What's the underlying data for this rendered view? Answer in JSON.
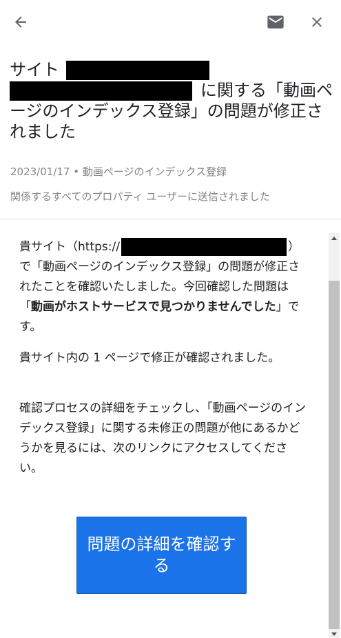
{
  "header": {
    "back_icon": "arrow-back-icon",
    "mail_icon": "mail-icon",
    "close_icon": "close-icon"
  },
  "title": {
    "prefix": "サイト",
    "suffix": "に関する「動画ページのインデックス登録」の問題が修正されました"
  },
  "meta": {
    "line1": "2023/01/17 • 動画ページのインデックス登録",
    "line2": "関係するすべてのプロパティ ユーザーに送信されました"
  },
  "body": {
    "p1_start": "貴サイト（https://",
    "p1_close": "）",
    "p1_mid": "で「動画ページのインデックス登録」の問題が修正されたことを確認いたしました。今回確認した問題は「",
    "p1_bold": "動画がホストサービスで見つかりませんでした",
    "p1_end": "」です。",
    "p2": "貴サイト内の 1 ページで修正が確認されました。",
    "p3": "確認プロセスの詳細をチェックし、「動画ページのインデックス登録」に関する未修正の問題が他にあるかどうかを見るには、次のリンクにアクセスしてください。"
  },
  "cta": {
    "label": "問題の詳細を確認する"
  },
  "colors": {
    "accent": "#1a73e8",
    "meta_text": "#80868b"
  }
}
